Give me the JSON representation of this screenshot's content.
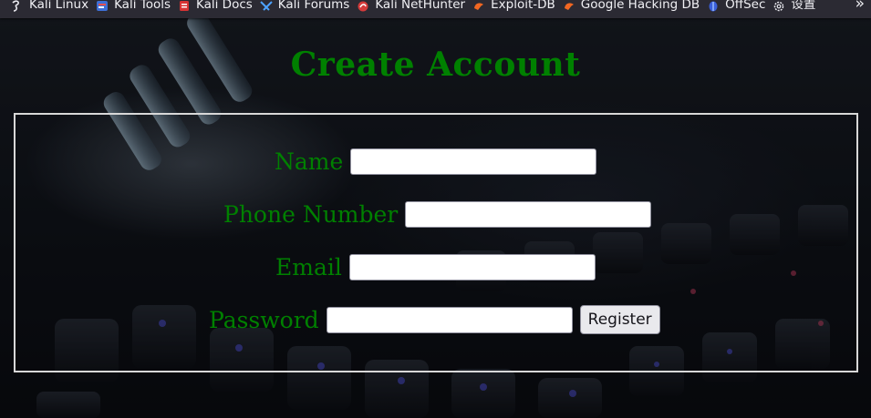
{
  "bookmarks": [
    {
      "label": "Kali Linux",
      "icon": "kali-dragon-icon"
    },
    {
      "label": "Kali Tools",
      "icon": "kali-tools-icon"
    },
    {
      "label": "Kali Docs",
      "icon": "kali-docs-icon"
    },
    {
      "label": "Kali Forums",
      "icon": "kali-forums-icon"
    },
    {
      "label": "Kali NetHunter",
      "icon": "nethunter-icon"
    },
    {
      "label": "Exploit-DB",
      "icon": "exploit-db-icon"
    },
    {
      "label": "Google Hacking DB",
      "icon": "ghdb-icon"
    },
    {
      "label": "OffSec",
      "icon": "offsec-icon"
    },
    {
      "label": "设置",
      "icon": "gear-icon"
    }
  ],
  "overflow_icon": "chevron-double-right-icon",
  "page": {
    "title": "Create Account",
    "title_color": "#008000"
  },
  "form": {
    "fields": [
      {
        "label": "Name",
        "value": "",
        "placeholder": ""
      },
      {
        "label": "Phone Number",
        "value": "",
        "placeholder": ""
      },
      {
        "label": "Email",
        "value": "",
        "placeholder": ""
      },
      {
        "label": "Password",
        "value": "",
        "placeholder": ""
      }
    ],
    "submit_label": "Register"
  }
}
